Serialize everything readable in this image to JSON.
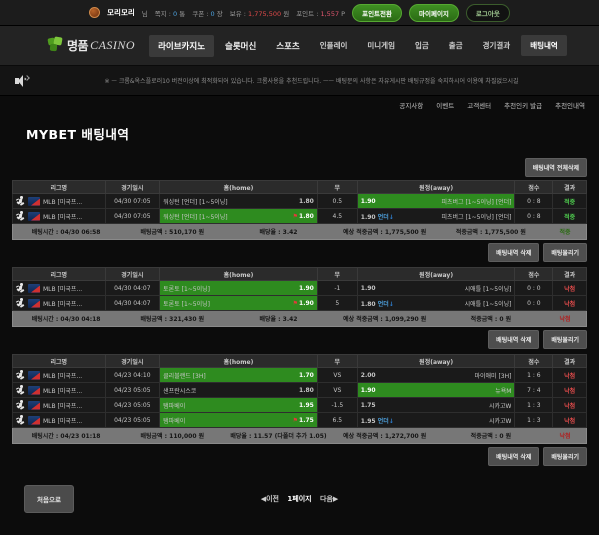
{
  "topbar": {
    "avatar": "user-avatar",
    "username": "모리모리",
    "username_suffix": "님",
    "message_label": "쪽지 :",
    "message_value": "0",
    "message_unit": "통",
    "coupon_label": "쿠폰 :",
    "coupon_value": "0",
    "coupon_unit": "장",
    "balance_label": "보유 :",
    "balance_value": "1,775,500",
    "balance_unit": "원",
    "point_label": "포인트 :",
    "point_value": "1,557",
    "point_unit": "P",
    "btn_point_exchange": "포인트전환",
    "btn_mypage": "마이페이지",
    "btn_logout": "로그아웃"
  },
  "header": {
    "logo_ko": "명품",
    "logo_en": "CASINO",
    "nav": [
      {
        "label": "라이브카지노",
        "active": true
      },
      {
        "label": "슬롯머신",
        "active": false
      },
      {
        "label": "스포츠",
        "active": false
      },
      {
        "label": "인플레이",
        "active": false
      },
      {
        "label": "미니게임",
        "active": false
      },
      {
        "label": "입금",
        "active": false
      },
      {
        "label": "출금",
        "active": false
      },
      {
        "label": "경기결과",
        "active": false
      },
      {
        "label": "배팅내역",
        "active": true
      }
    ]
  },
  "notice": {
    "icon": "speaker-icon",
    "text": "※ ㅡ 크롬&옥스플로러10 버전이상에 최적화되어 있습니다. 크롬사용을 추천드립니다. ㅡㅡ 배팅문의 사항은 자유게시판 배팅규정을 숙지하시어 이용에 차질없으시길"
  },
  "subnav": [
    "공지사항",
    "이벤트",
    "고객센터",
    "추천인키 발급",
    "추천인내역"
  ],
  "page_title": "MYBET 배팅내역",
  "buttons": {
    "delete_all": "배팅내역 전체삭제",
    "delete_one": "배팅내역 삭제",
    "cancel_bet": "배팅물리기",
    "home": "처음으로"
  },
  "table_headers": [
    "리그명",
    "경기일시",
    "홈(home)",
    "무",
    "원정(away)",
    "점수",
    "결과"
  ],
  "summary_labels": {
    "time": "배팅시간 :",
    "amount": "배팅금액 :",
    "rate": "배당율 :",
    "expected": "예상 적중금액 :",
    "payout": "적중금액 :"
  },
  "cards": [
    {
      "rows": [
        {
          "league": "MLB [미국프...",
          "date": "04/30 07:05",
          "home_name": "워싱턴 [언더] [1~5이닝]",
          "home_odds": "1.80",
          "home_selected": false,
          "home_pin": false,
          "draw": "0.5",
          "away_name": "피츠버그 [1~5이닝] [언더]",
          "away_odds": "1.90",
          "away_selected": true,
          "away_extra": "",
          "score": "0 : 8",
          "result": "적중",
          "result_type": "win"
        },
        {
          "league": "MLB [미국프...",
          "date": "04/30 07:05",
          "home_name": "워싱턴 [언더] [1~5이닝]",
          "home_odds": "1.80",
          "home_selected": true,
          "home_pin": true,
          "draw": "4.5",
          "away_name": "피츠버그 [1~5이닝] [언더]",
          "away_odds": "1.90",
          "away_selected": false,
          "away_extra": "언더",
          "score": "0 : 8",
          "result": "적중",
          "result_type": "win"
        }
      ],
      "summary": {
        "time": "04/30 06:58",
        "amount": "510,170 원",
        "rate": "3.42",
        "expected": "1,775,500 원",
        "payout": "1,775,500 원",
        "status": "적중",
        "status_type": "win"
      }
    },
    {
      "rows": [
        {
          "league": "MLB [미국프...",
          "date": "04/30 04:07",
          "home_name": "토론토 [1~5이닝]",
          "home_odds": "1.90",
          "home_selected": true,
          "home_pin": false,
          "draw": "-1",
          "away_name": "시애틀 [1~5이닝]",
          "away_odds": "1.90",
          "away_selected": false,
          "away_extra": "",
          "score": "0 : 0",
          "result": "낙첨",
          "result_type": "lose"
        },
        {
          "league": "MLB [미국프...",
          "date": "04/30 04:07",
          "home_name": "토론토 [1~5이닝]",
          "home_odds": "1.90",
          "home_selected": true,
          "home_pin": true,
          "draw": "5",
          "away_name": "시애틀 [1~5이닝]",
          "away_odds": "1.80",
          "away_selected": false,
          "away_extra": "언더",
          "score": "0 : 0",
          "result": "낙첨",
          "result_type": "lose"
        }
      ],
      "summary": {
        "time": "04/30 04:18",
        "amount": "321,430 원",
        "rate": "3.42",
        "expected": "1,099,290 원",
        "payout": "0 원",
        "status": "낙첨",
        "status_type": "lose"
      }
    },
    {
      "rows": [
        {
          "league": "MLB [미국프...",
          "date": "04/23 04:10",
          "home_name": "클리블랜드 [3H]",
          "home_odds": "1.70",
          "home_selected": true,
          "home_pin": false,
          "draw": "VS",
          "away_name": "마이애미 [3H]",
          "away_odds": "2.00",
          "away_selected": false,
          "away_extra": "",
          "score": "1 : 6",
          "result": "낙첨",
          "result_type": "lose"
        },
        {
          "league": "MLB [미국프...",
          "date": "04/23 05:05",
          "home_name": "샌프란시스코",
          "home_odds": "1.80",
          "home_selected": false,
          "home_pin": false,
          "draw": "VS",
          "away_name": "뉴욕M",
          "away_odds": "1.90",
          "away_selected": true,
          "away_extra": "",
          "score": "7 : 4",
          "result": "낙첨",
          "result_type": "lose"
        },
        {
          "league": "MLB [미국프...",
          "date": "04/23 05:05",
          "home_name": "탬파베이",
          "home_odds": "1.95",
          "home_selected": true,
          "home_pin": false,
          "draw": "-1.5",
          "away_name": "시카고W",
          "away_odds": "1.75",
          "away_selected": false,
          "away_extra": "",
          "score": "1 : 3",
          "result": "낙첨",
          "result_type": "lose"
        },
        {
          "league": "MLB [미국프...",
          "date": "04/23 05:05",
          "home_name": "탬파베이",
          "home_odds": "1.75",
          "home_selected": true,
          "home_pin": true,
          "draw": "6.5",
          "away_name": "시카고W",
          "away_odds": "1.95",
          "away_selected": false,
          "away_extra": "언더",
          "score": "1 : 3",
          "result": "낙첨",
          "result_type": "lose"
        }
      ],
      "summary": {
        "time": "04/23 01:18",
        "amount": "110,000 원",
        "rate": "11.57 (다폴더 추가 1.05)",
        "expected": "1,272,700 원",
        "payout": "0 원",
        "status": "낙첨",
        "status_type": "lose"
      }
    }
  ],
  "pager": {
    "prev": "◀이전",
    "current": "1페이지",
    "next": "다음▶"
  }
}
